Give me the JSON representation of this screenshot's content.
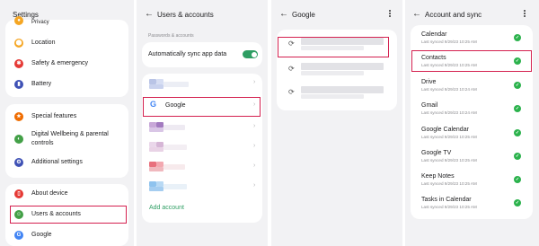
{
  "panel1": {
    "title": "Settings",
    "items": [
      {
        "label": "Privacy",
        "icon": "privacy-icon",
        "color": "#f5a623"
      },
      {
        "label": "Location",
        "icon": "location-icon",
        "color": "#f5a623"
      },
      {
        "label": "Safety & emergency",
        "icon": "safety-icon",
        "color": "#e53935"
      },
      {
        "label": "Battery",
        "icon": "battery-icon",
        "color": "#3f51b5"
      },
      {
        "label": "Special features",
        "icon": "star-icon",
        "color": "#ef6c00"
      },
      {
        "label": "Digital Wellbeing & parental controls",
        "icon": "wellbeing-icon",
        "color": "#43a047"
      },
      {
        "label": "Additional settings",
        "icon": "gear-icon",
        "color": "#3f51b5"
      },
      {
        "label": "About device",
        "icon": "phone-icon",
        "color": "#e53935"
      },
      {
        "label": "Users & accounts",
        "icon": "user-icon",
        "color": "#43a047"
      },
      {
        "label": "Google",
        "icon": "google-icon",
        "color": "#4285f4"
      }
    ]
  },
  "panel2": {
    "title": "Users & accounts",
    "section_label": "Passwords & accounts",
    "auto_sync_label": "Automatically sync app data",
    "auto_sync_on": true,
    "google_label": "Google",
    "add_account_label": "Add account",
    "accent": "#2e9e63"
  },
  "panel3": {
    "title": "Google"
  },
  "panel4": {
    "title": "Account and sync",
    "rows": [
      {
        "title": "Calendar",
        "sub": "Last synced 9/29/23 10:25 AM"
      },
      {
        "title": "Contacts",
        "sub": "Last synced 9/29/23 10:25 AM"
      },
      {
        "title": "Drive",
        "sub": "Last synced 9/29/23 10:24 AM"
      },
      {
        "title": "Gmail",
        "sub": "Last synced 9/29/23 10:24 AM"
      },
      {
        "title": "Google Calendar",
        "sub": "Last synced 9/29/23 10:25 AM"
      },
      {
        "title": "Google TV",
        "sub": "Last synced 9/29/23 10:25 AM"
      },
      {
        "title": "Keep Notes",
        "sub": "Last synced 9/29/23 10:25 AM"
      },
      {
        "title": "Tasks in Calendar",
        "sub": "Last synced 9/29/23 10:25 AM"
      }
    ],
    "check_color": "#2bb24c"
  },
  "highlight_color": "#d4204f"
}
